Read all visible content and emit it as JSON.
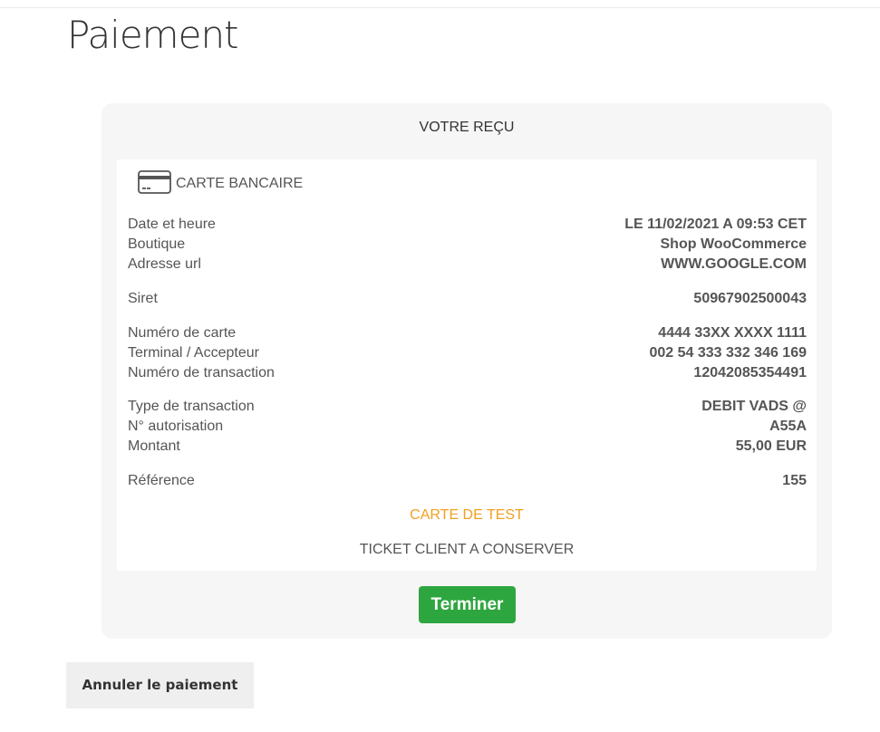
{
  "page": {
    "title": "Paiement"
  },
  "receipt": {
    "heading": "VOTRE REÇU",
    "card_type": {
      "icon": "credit-card-icon",
      "label": "CARTE BANCAIRE"
    },
    "rows": [
      {
        "label": "Date et heure",
        "value": "LE 11/02/2021 A 09:53 CET"
      },
      {
        "label": "Boutique",
        "value": "Shop WooCommerce"
      },
      {
        "label": "Adresse url",
        "value": "WWW.GOOGLE.COM"
      },
      {
        "label": "Siret",
        "value": "50967902500043"
      },
      {
        "label": "Numéro de carte",
        "value": "4444 33XX XXXX 1111"
      },
      {
        "label": "Terminal / Accepteur",
        "value": "002 54 333 332 346 169"
      },
      {
        "label": "Numéro de transaction",
        "value": "12042085354491"
      },
      {
        "label": "Type de transaction",
        "value": "DEBIT VADS @"
      },
      {
        "label": "N° autorisation",
        "value": "A55A"
      },
      {
        "label": "Montant",
        "value": "55,00 EUR"
      },
      {
        "label": "Référence",
        "value": "155"
      }
    ],
    "test_card_note": "CARTE DE TEST",
    "ticket_note": "TICKET CLIENT A CONSERVER"
  },
  "actions": {
    "finish_label": "Terminer",
    "cancel_label": "Annuler le paiement"
  },
  "colors": {
    "finish_button": "#2ea640",
    "test_card_text": "#f0a020",
    "panel_background": "#f6f6f6"
  }
}
